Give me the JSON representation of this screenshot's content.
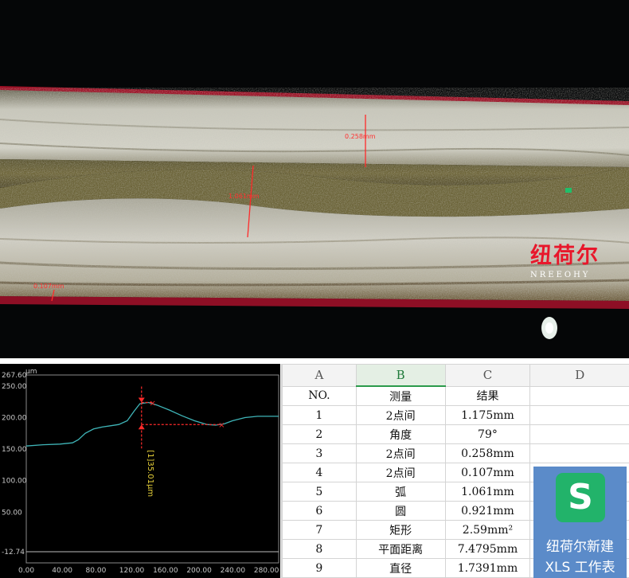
{
  "microscope": {
    "measurement_labels": [
      "0.258mm",
      "1.061mm",
      "0.107mm"
    ],
    "brand_cn": "纽荷尔",
    "brand_en": "NREEOHY"
  },
  "profile_chart": {
    "unit": "µm",
    "y_ticks": [
      "267.60",
      "250.00",
      "200.00",
      "150.00",
      "100.00",
      "50.00",
      "-12.74"
    ],
    "x_ticks": [
      "0.00",
      "40.00",
      "80.00",
      "120.00",
      "160.00",
      "200.00",
      "240.00",
      "280.00"
    ],
    "measure_label": "[1]35.01µm"
  },
  "chart_data": {
    "type": "line",
    "xlabel": "",
    "ylabel": "µm",
    "xlim": [
      0,
      300
    ],
    "ylim": [
      -12.74,
      267.6
    ],
    "series": [
      {
        "x": [
          0,
          20,
          40,
          55,
          62,
          70,
          80,
          90,
          100,
          110,
          120,
          128,
          135,
          145,
          155,
          170,
          185,
          200,
          215,
          225,
          235,
          245,
          260,
          275,
          290,
          300
        ],
        "values": [
          155,
          157,
          158,
          160,
          165,
          175,
          182,
          185,
          187,
          189,
          195,
          210,
          222,
          224,
          220,
          212,
          203,
          195,
          189,
          188,
          190,
          195,
          200,
          202,
          202,
          202
        ]
      }
    ],
    "annotation": {
      "label": "[1]35.01µm",
      "x": 137,
      "y_low": 189,
      "y_high": 224
    }
  },
  "sheet": {
    "col_headers": [
      "A",
      "B",
      "C",
      "D"
    ],
    "rows": [
      [
        "NO.",
        "测量",
        "结果"
      ],
      [
        "1",
        "2点间",
        "1.175mm"
      ],
      [
        "2",
        "角度",
        "79°"
      ],
      [
        "3",
        "2点间",
        "0.258mm"
      ],
      [
        "4",
        "2点间",
        "0.107mm"
      ],
      [
        "5",
        "弧",
        "1.061mm"
      ],
      [
        "6",
        "圆",
        "0.921mm"
      ],
      [
        "7",
        "矩形",
        "2.59mm²"
      ],
      [
        "8",
        "平面距离",
        "7.4795mm"
      ],
      [
        "9",
        "直径",
        "1.7391mm"
      ]
    ]
  },
  "wps_tile": {
    "icon_glyph": "S",
    "line1": "纽荷尔新建",
    "line2": "XLS 工作表",
    "color": "#5b8bc9",
    "icon_color": "#22b36a"
  }
}
